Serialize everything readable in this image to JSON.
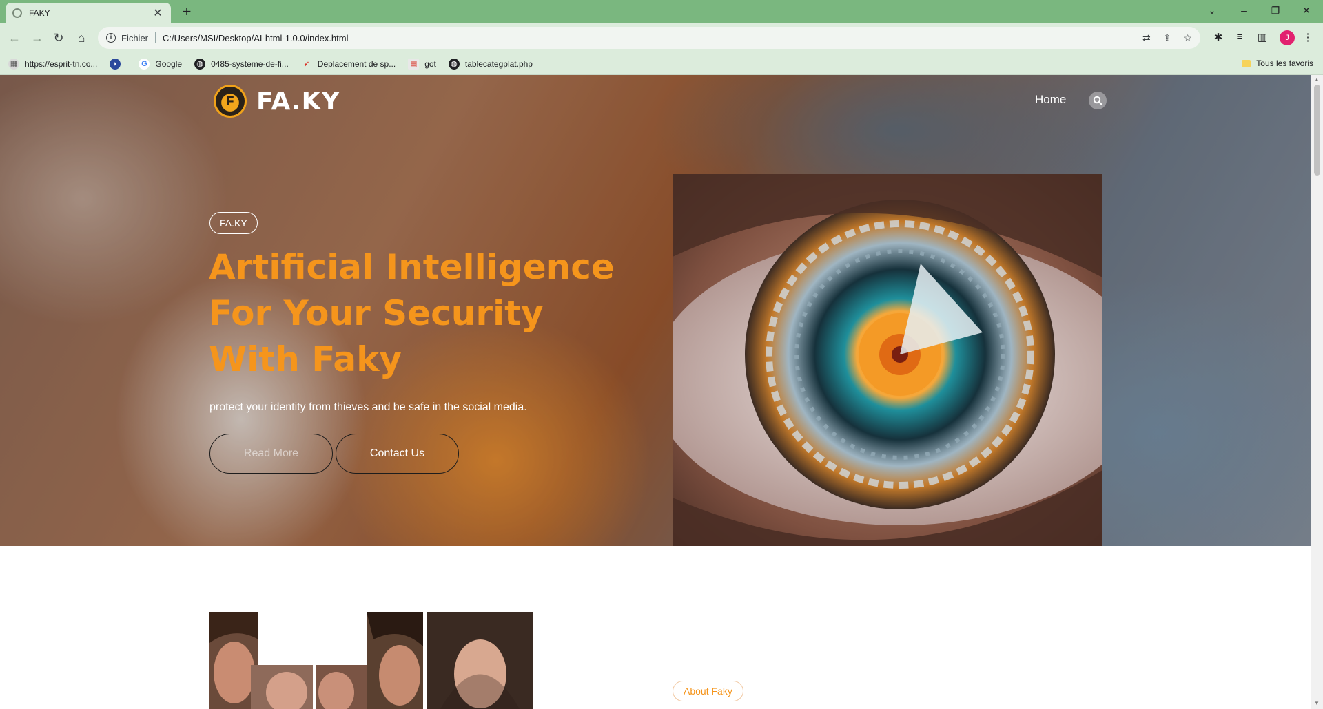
{
  "browser": {
    "tab_title": "FAKY",
    "new_tab": "+",
    "scheme_label": "Fichier",
    "url": "C:/Users/MSI/Desktop/AI-html-1.0.0/index.html",
    "profile_initial": "J",
    "bookmarks": [
      {
        "label": "https://esprit-tn.co...",
        "icon": "site-icon"
      },
      {
        "label": "",
        "icon": "app-icon"
      },
      {
        "label": "Google",
        "icon": "google-icon"
      },
      {
        "label": "0485-systeme-de-fi...",
        "icon": "globe-icon"
      },
      {
        "label": "Deplacement de sp...",
        "icon": "app-icon"
      },
      {
        "label": "got",
        "icon": "site-icon"
      },
      {
        "label": "tablecategplat.php",
        "icon": "globe-icon"
      }
    ],
    "all_bookmarks_label": "Tous les favoris"
  },
  "site": {
    "logo_badge": "F",
    "logo_text": "FA.KY",
    "nav_home": "Home",
    "hero": {
      "pill": "FA.KY",
      "headline": "Artificial Intelligence For Your Security With Faky",
      "tagline": "protect your identity from thieves and be safe in the social media.",
      "read_more": "Read More",
      "contact_us": "Contact Us"
    },
    "about": {
      "pill": "About Faky"
    }
  },
  "colors": {
    "accent": "#f5951c",
    "tab_bar": "#7ab77f",
    "toolbar": "#dcecdc"
  }
}
